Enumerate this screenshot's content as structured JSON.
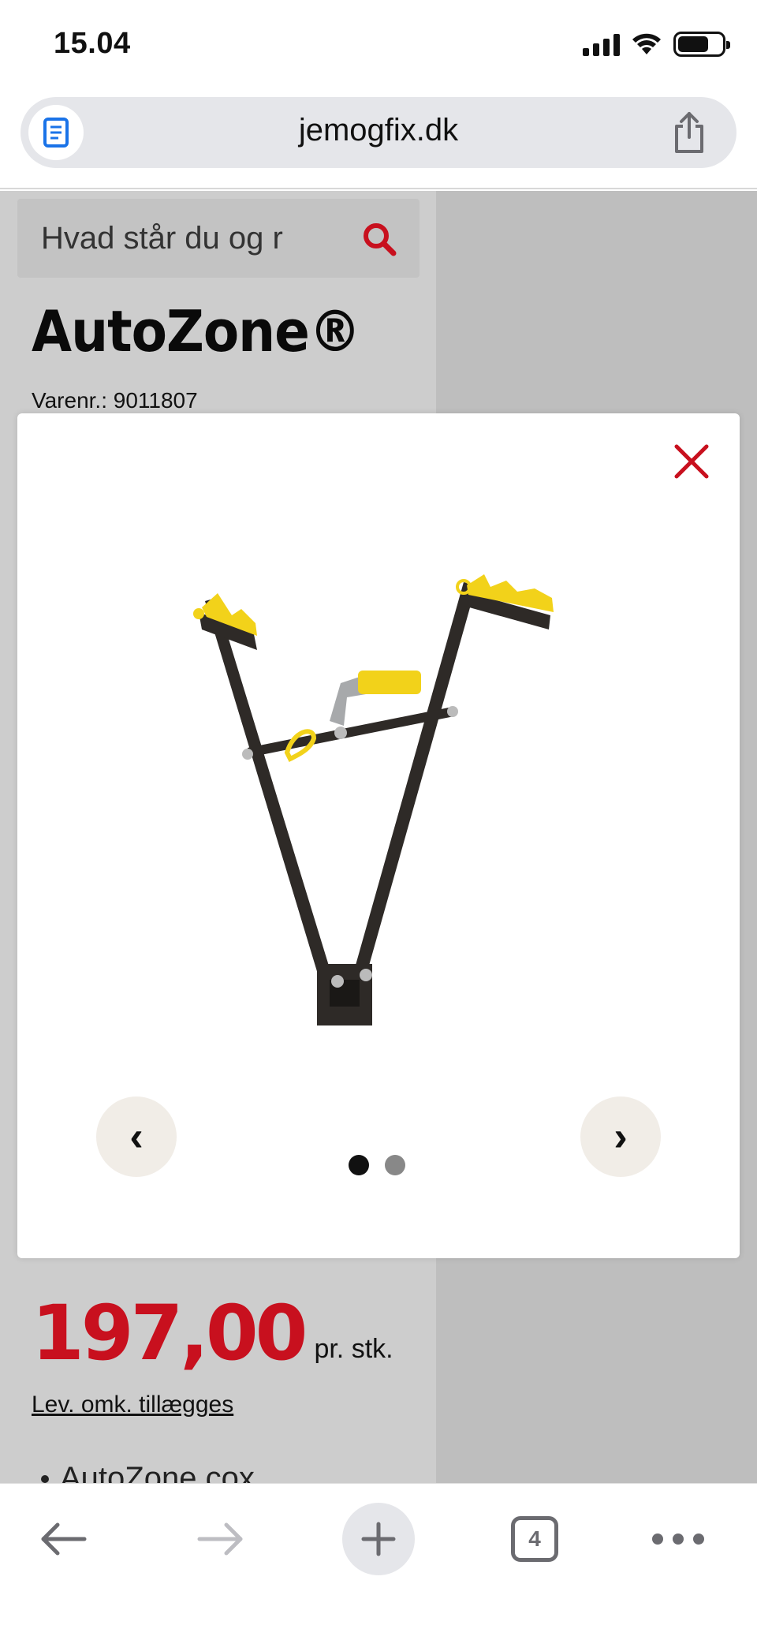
{
  "status_bar": {
    "time": "15.04",
    "icons": [
      "signal-icon",
      "wifi-icon",
      "battery-icon"
    ]
  },
  "browser": {
    "url": "jemogfix.dk",
    "reader_icon": "reader-mode-icon",
    "share_icon": "share-icon"
  },
  "page": {
    "search": {
      "placeholder": "Hvad står du og r",
      "icon": "search-icon"
    },
    "title_partial": "AutoZone®",
    "sku": "Varenr.: 9011807",
    "price": "197,00",
    "price_unit": "pr. stk.",
    "delivery_link": "Lev. omk. tillægges",
    "bullet_partial": "AutoZone cox"
  },
  "gallery_modal": {
    "close_icon": "close-icon",
    "image_alt": "bike-rack-product-image",
    "prev_label": "‹",
    "next_label": "›",
    "dots_count": 2,
    "active_dot": 1
  },
  "toolbar": {
    "back_icon": "back-arrow-icon",
    "forward_icon": "forward-arrow-icon",
    "new_tab_icon": "plus-icon",
    "tab_count": "4",
    "more_icon": "more-icon"
  },
  "colors": {
    "accent_red": "#c8101e",
    "product_yellow": "#f2d21a",
    "product_frame": "#2e2a27"
  }
}
